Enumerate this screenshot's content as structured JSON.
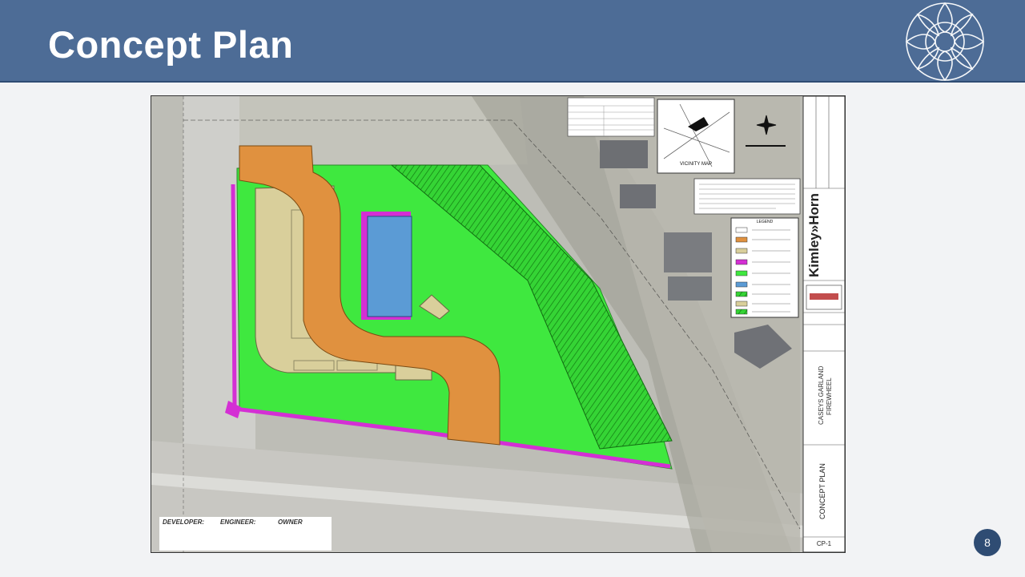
{
  "slide": {
    "title": "Concept Plan",
    "page_number": "8"
  },
  "plan": {
    "legend_title": "LEGEND",
    "vicinity_label": "VICINITY MAP",
    "firm_name": "Kimley»Horn",
    "project_name_line1": "CASEYS GARLAND",
    "project_name_line2": "FIREWHEEL",
    "sheet_title": "CONCEPT PLAN",
    "sheet_number": "CP-1"
  },
  "credits": {
    "developer_label": "DEVELOPER:",
    "engineer_label": "ENGINEER:",
    "owner_label": "OWNER"
  },
  "colors": {
    "header": "#4d6c96",
    "access_drive": "#e0913f",
    "parking": "#d9cf9b",
    "building": "#5b9bd5",
    "sidewalk": "#d42fd4",
    "landscape": "#3fe83f",
    "hatched_area": "#2fbf2f"
  }
}
